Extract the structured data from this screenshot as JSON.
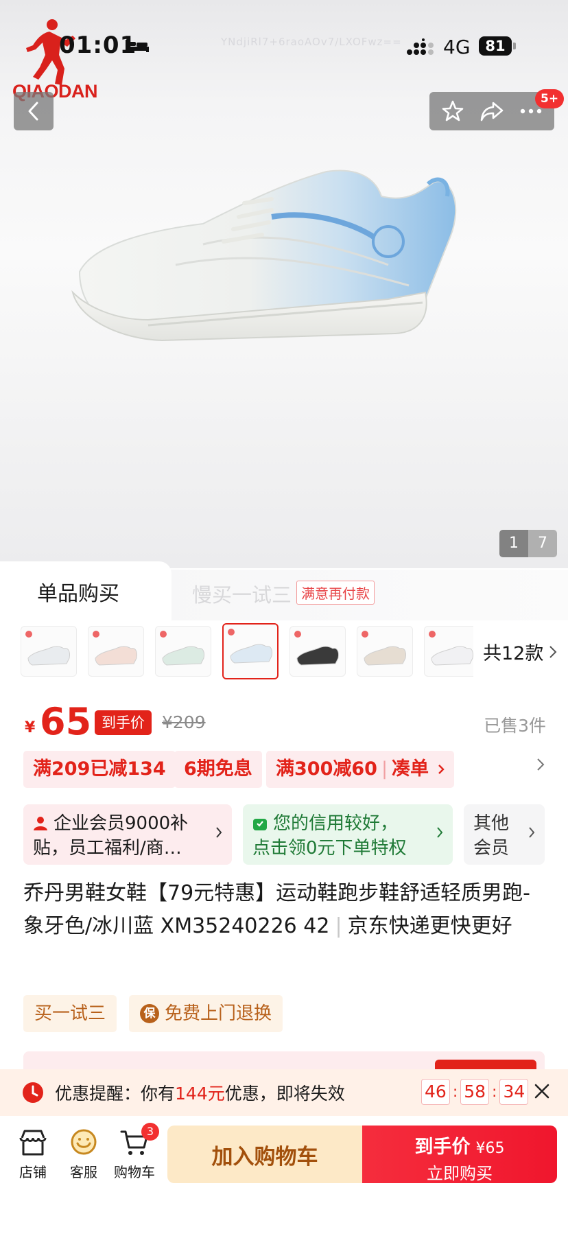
{
  "status_bar": {
    "time": "01:01",
    "network": "4G",
    "battery": "81",
    "watermark": "YNdjiRl7+6raoAOv7/LXOFwz=="
  },
  "brand": {
    "name": "QIAODAN"
  },
  "header": {
    "notification_badge": "5+"
  },
  "gallery": {
    "current_page": "1",
    "total_pages": "7"
  },
  "purchase_tabs": {
    "single": "单品购买",
    "trial": "慢买一试三",
    "trial_tag": "满意再付款"
  },
  "variants": {
    "more_label": "共12款",
    "items": [
      {
        "name": "white-silver",
        "color": "#e9ecef"
      },
      {
        "name": "white-pink",
        "color": "#f3ded6"
      },
      {
        "name": "white-green",
        "color": "#dcebe3"
      },
      {
        "name": "ivory-blue",
        "color": "#dde9f3",
        "selected": true
      },
      {
        "name": "white-black",
        "color": "#3a3a3a"
      },
      {
        "name": "beige",
        "color": "#e6ddd2"
      },
      {
        "name": "pure-white",
        "color": "#f1f1f3"
      }
    ]
  },
  "price": {
    "currency": "¥",
    "value": "65",
    "tag": "到手价",
    "original": "¥209",
    "sold": "已售3件"
  },
  "promos": {
    "chip1": "满209已减134",
    "chip2": "6期免息",
    "chip3": "满300减60",
    "chip3_action": "凑单"
  },
  "cards": {
    "member_line1": "企业会员9000补",
    "member_line2": "贴，员工福利/商…",
    "credit_line1": "您的信用较好，",
    "credit_line2": "点击领0元下单特权",
    "other_line1": "其他",
    "other_line2": "会员"
  },
  "product": {
    "title": "乔丹男鞋女鞋【79元特惠】运动鞋跑步鞋舒适轻质男跑-象牙色/冰川蓝 XM35240226 42",
    "shipping": "京东快递更快更好"
  },
  "service_tags": {
    "trial": "买一试三",
    "return_icon": "保",
    "returns": "免费上门退换"
  },
  "reminder": {
    "prefix": "优惠提醒：你有",
    "amount": "144元",
    "suffix": "优惠，即将失效",
    "hours": "46",
    "minutes": "58",
    "seconds": "34"
  },
  "bottom_bar": {
    "shop": "店铺",
    "service": "客服",
    "cart": "购物车",
    "cart_count": "3",
    "add_to_cart": "加入购物车",
    "buy_line1": "到手价",
    "buy_price": "¥65",
    "buy_line2": "立即购买"
  },
  "colors": {
    "accent_red": "#e2231a",
    "promo_bg": "#fdecee",
    "credit_green": "#1f7a36",
    "add_cart_bg": "#fde9c7"
  }
}
